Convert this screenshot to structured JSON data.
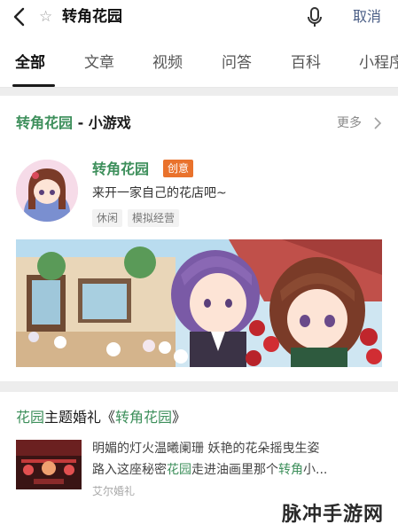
{
  "search": {
    "query": "转角花园",
    "cancel_label": "取消"
  },
  "tabs": [
    "全部",
    "文章",
    "视频",
    "问答",
    "百科",
    "小程序"
  ],
  "game_card": {
    "section_title_highlight": "转角花园",
    "section_title_suffix": " - 小游戏",
    "more_label": "更多",
    "app_name": "转角花园",
    "badge": "创意",
    "description": "来开一家自己的花店吧~",
    "tags": [
      "休闲",
      "模拟经营"
    ]
  },
  "article": {
    "title_part1": "花园",
    "title_part2": "主题婚礼《",
    "title_part3": "转角花园",
    "title_part4": "》",
    "line1": "明媚的灯火温曦阑珊 妖艳的花朵摇曳生姿",
    "line2_part1": "路入这座秘密",
    "line2_part2": "花园",
    "line2_part3": "走进油画里那个",
    "line2_part4": "转角",
    "line2_part5": "小...",
    "source": "艾尔婚礼"
  },
  "watermark": "脉冲手游网",
  "colors": {
    "highlight": "#3d8f5b",
    "badge": "#e9722c",
    "cancel": "#4a5e86"
  }
}
